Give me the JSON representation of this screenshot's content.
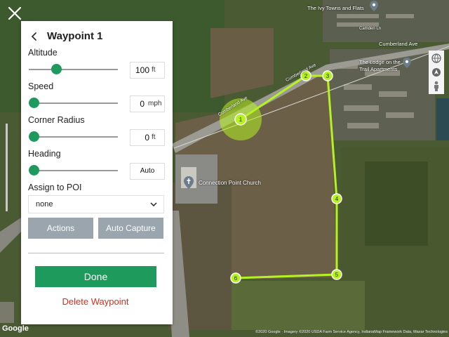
{
  "map": {
    "labels": {
      "ivy_towns": "The Ivy Towns and Flats",
      "camden": "Camden Ln",
      "cumberland_top": "Cumberland Ave",
      "cumberland_mid": "Cumberland Ave",
      "cumberland_left": "Cumberland Ave",
      "lodge_line1": "The Lodge on the",
      "lodge_line2": "Trail Apartments",
      "church": "Connection Point Church"
    },
    "waypoints": [
      "1",
      "2",
      "3",
      "4",
      "5",
      "6"
    ],
    "path_color": "#b6f221",
    "google_logo": "Google",
    "attribution": "©2020 Google · Imagery ©2020 USDA Farm Service Agency, IndianaMap Framework Data, Maxar Technologies"
  },
  "panel": {
    "title": "Waypoint 1",
    "altitude": {
      "label": "Altitude",
      "value": "100",
      "unit": "ft",
      "slider_fraction": 0.25
    },
    "speed": {
      "label": "Speed",
      "value": "0",
      "unit": "mph",
      "slider_fraction": 0.0
    },
    "corner_radius": {
      "label": "Corner Radius",
      "value": "0",
      "unit": "ft",
      "slider_fraction": 0.0
    },
    "heading": {
      "label": "Heading",
      "value": "Auto",
      "slider_fraction": 0.0
    },
    "assign_poi": {
      "label": "Assign to POI",
      "selected": "none"
    },
    "actions_button": "Actions",
    "auto_capture_button": "Auto Capture",
    "done_button": "Done",
    "delete_button": "Delete Waypoint"
  },
  "colors": {
    "accent": "#1e9a5c",
    "delete": "#d42e1e",
    "secondary_button": "#9aa5ae"
  },
  "icons": {
    "close": "close-icon",
    "back": "chevron-left-icon",
    "dropdown": "chevron-down-icon",
    "globe": "globe-icon",
    "location": "compass-icon",
    "pegman": "pegman-icon"
  }
}
